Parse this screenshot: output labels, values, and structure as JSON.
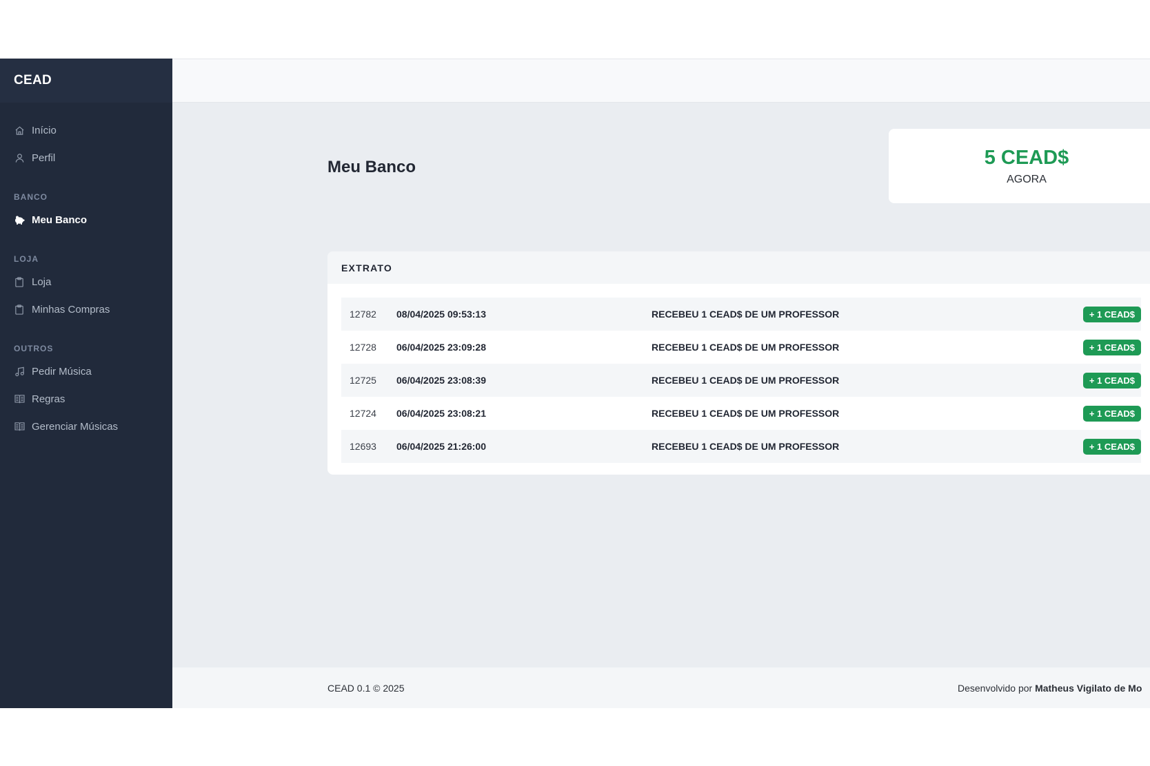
{
  "brand": "CEAD",
  "nav": {
    "items_main": [
      {
        "label": "Início",
        "icon": "home-icon"
      },
      {
        "label": "Perfil",
        "icon": "user-icon"
      }
    ],
    "section_banco": "BANCO",
    "banco_item": {
      "label": "Meu Banco",
      "icon": "piggy-bank-icon"
    },
    "section_loja": "LOJA",
    "loja_items": [
      {
        "label": "Loja",
        "icon": "clipboard-icon"
      },
      {
        "label": "Minhas Compras",
        "icon": "clipboard-icon"
      }
    ],
    "section_outros": "OUTROS",
    "outros_items": [
      {
        "label": "Pedir Música",
        "icon": "music-note-icon"
      },
      {
        "label": "Regras",
        "icon": "book-icon"
      },
      {
        "label": "Gerenciar Músicas",
        "icon": "book-icon"
      }
    ]
  },
  "page": {
    "title": "Meu Banco",
    "balance_value": "5 CEAD$",
    "balance_label": "AGORA"
  },
  "extrato": {
    "title": "EXTRATO",
    "rows": [
      {
        "id": "12782",
        "date": "08/04/2025 09:53:13",
        "desc": "RECEBEU 1 CEAD$ DE UM PROFESSOR",
        "amount": "+ 1 CEAD$"
      },
      {
        "id": "12728",
        "date": "06/04/2025 23:09:28",
        "desc": "RECEBEU 1 CEAD$ DE UM PROFESSOR",
        "amount": "+ 1 CEAD$"
      },
      {
        "id": "12725",
        "date": "06/04/2025 23:08:39",
        "desc": "RECEBEU 1 CEAD$ DE UM PROFESSOR",
        "amount": "+ 1 CEAD$"
      },
      {
        "id": "12724",
        "date": "06/04/2025 23:08:21",
        "desc": "RECEBEU 1 CEAD$ DE UM PROFESSOR",
        "amount": "+ 1 CEAD$"
      },
      {
        "id": "12693",
        "date": "06/04/2025 21:26:00",
        "desc": "RECEBEU 1 CEAD$ DE UM PROFESSOR",
        "amount": "+ 1 CEAD$"
      }
    ]
  },
  "footer": {
    "left": "CEAD 0.1 © 2025",
    "right_prefix": "Desenvolvido por",
    "right_name": "Matheus Vigilato de Mo"
  },
  "colors": {
    "sidebar": "#212a3b",
    "accent_green": "#1e9a55",
    "background": "#eaedf1"
  }
}
